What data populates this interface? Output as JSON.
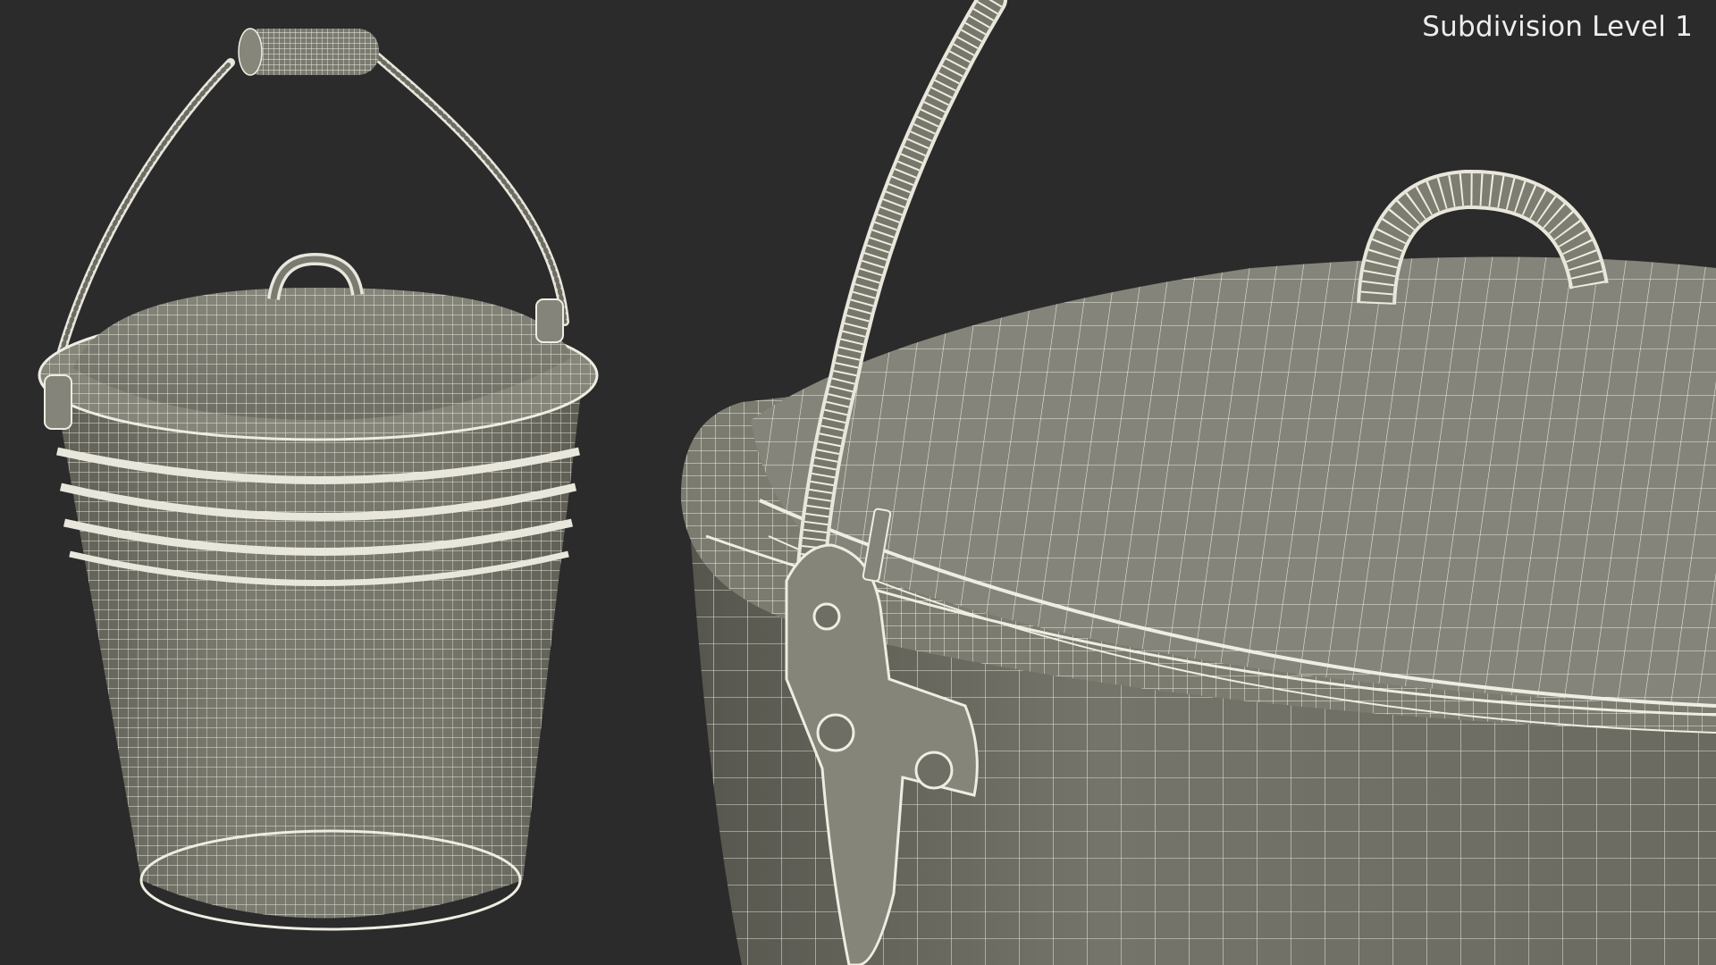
{
  "overlay": {
    "subdivision_label": "Subdivision Level 1"
  },
  "scene": {
    "background_color": "#2b2b2b",
    "mesh_fill_color": "#76766c",
    "wire_color": "#f0eee4",
    "views": [
      {
        "name": "full-bucket-view",
        "subject": "metal-bucket-with-lid-wireframe"
      },
      {
        "name": "closeup-view",
        "subject": "bucket-lid-and-handle-hinge-wireframe"
      }
    ]
  }
}
